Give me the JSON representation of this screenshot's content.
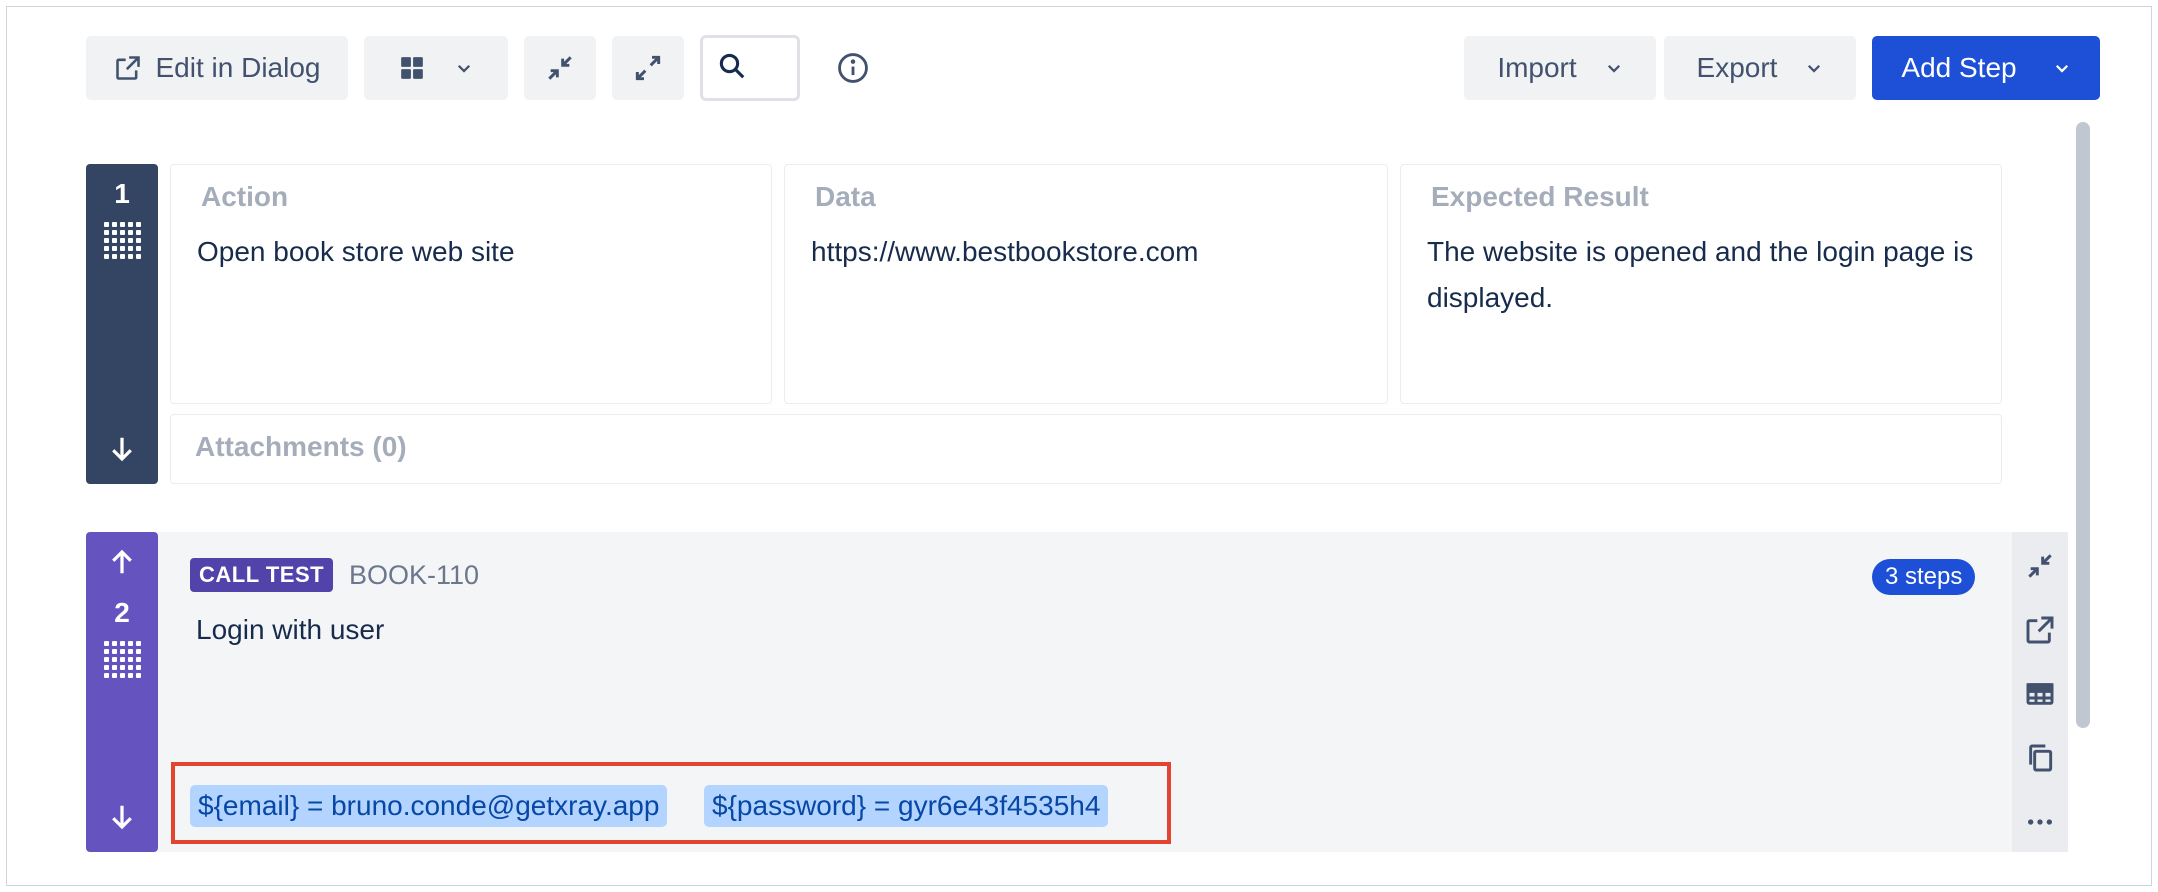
{
  "toolbar": {
    "edit_dialog_label": "Edit in Dialog",
    "import_label": "Import",
    "export_label": "Export",
    "add_step_label": "Add Step"
  },
  "step1": {
    "number": "1",
    "action_label": "Action",
    "action_value": "Open book store web site",
    "data_label": "Data",
    "data_value": "https://www.bestbookstore.com",
    "expected_label": "Expected Result",
    "expected_value": "The website is opened and the login page is displayed.",
    "attachments_label": "Attachments (0)"
  },
  "step2": {
    "number": "2",
    "badge": "CALL TEST",
    "issue_key": "BOOK-110",
    "steps_count": "3 steps",
    "title": "Login with user",
    "params": [
      "${email} = bruno.conde@getxray.app",
      "${password} = gyr6e43f4535h4"
    ]
  },
  "colors": {
    "primary": "#1d4fd7",
    "step1_handle": "#344563",
    "step2_handle": "#6554c0",
    "call_test_badge": "#5243aa",
    "param_lozenge": "#b3d4ff",
    "highlight_border": "#e2442f"
  },
  "icons": [
    "external-link-icon",
    "grid-layout-icon",
    "chevron-down-icon",
    "collapse-icon",
    "expand-icon",
    "search-icon",
    "info-icon",
    "drag-grip-icon",
    "arrow-down-icon",
    "arrow-up-icon",
    "table-icon",
    "copy-icon",
    "more-icon"
  ]
}
